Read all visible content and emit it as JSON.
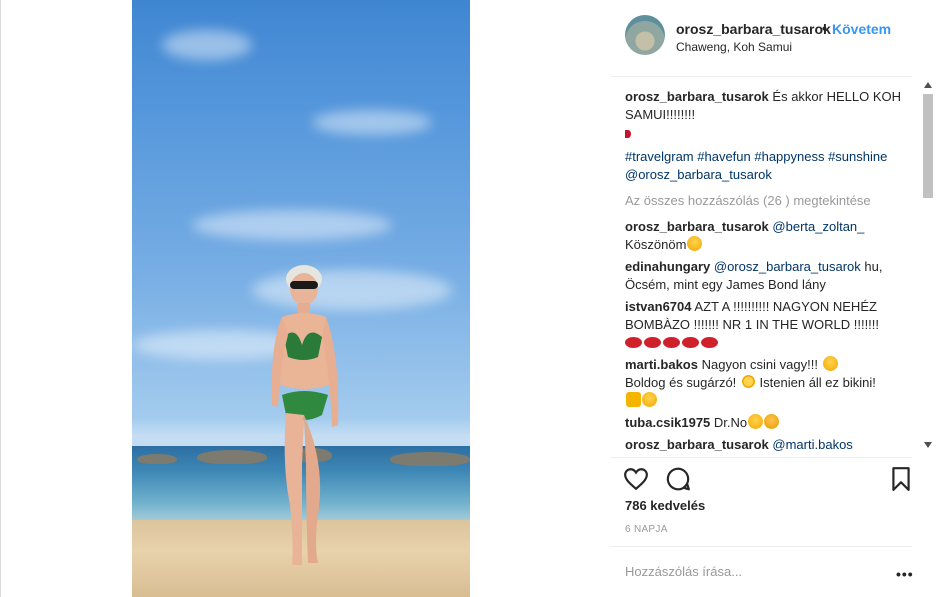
{
  "post": {
    "username": "orosz_barbara_tusarok",
    "follow_label": "Követem",
    "location": "Chaweng, Koh Samui",
    "caption_text": "És akkor HELLO KOH SAMUI!!!!!!!!",
    "hashtags": "#travelgram #havefun #happyness #sunshine @orosz_barbara_tusarok",
    "view_all_comments": "Az összes hozzászólás (26 ) megtekintése"
  },
  "comments": [
    {
      "user": "orosz_barbara_tusarok",
      "mention": "@berta_zoltan_",
      "text": "Köszönöm",
      "emojis": [
        "smile"
      ]
    },
    {
      "user": "edinahungary",
      "mention": "@orosz_barbara_tusarok",
      "text": "hu, Öcsém, mint egy James Bond lány",
      "emojis": []
    },
    {
      "user": "istvan6704",
      "mention": "",
      "text": "AZT A !!!!!!!!!! NAGYON NEHÉZ BOMBÀZO !!!!!!! NR 1 IN THE WORLD !!!!!!!",
      "emojis": [
        "lips",
        "lips",
        "lips",
        "lips",
        "lips"
      ]
    },
    {
      "user": "marti.bakos",
      "mention": "",
      "text": "Nagyon csini vagy!!!",
      "text2": "Boldog és sugárzó!",
      "text3": "Istenien áll ez bikini!",
      "emojis": [
        "heart-eyes",
        "sun",
        "thumb",
        "heart-eyes"
      ]
    },
    {
      "user": "tuba.csik1975",
      "mention": "",
      "text": "Dr.No",
      "emojis": [
        "wink",
        "kiss"
      ]
    },
    {
      "user": "orosz_barbara_tusarok",
      "mention": "@marti.bakos",
      "text": "",
      "emojis": []
    }
  ],
  "stats": {
    "likes": "786 kedvelés",
    "time_ago": "6 NAPJA"
  },
  "composer": {
    "placeholder": "Hozzászólás írása...",
    "more_label": "•••"
  },
  "icons": {
    "like": "heart-outline-icon",
    "comment": "comment-bubble-icon",
    "save": "bookmark-icon"
  },
  "colors": {
    "link_blue": "#3897f0",
    "text": "#262626",
    "muted": "#999999"
  }
}
